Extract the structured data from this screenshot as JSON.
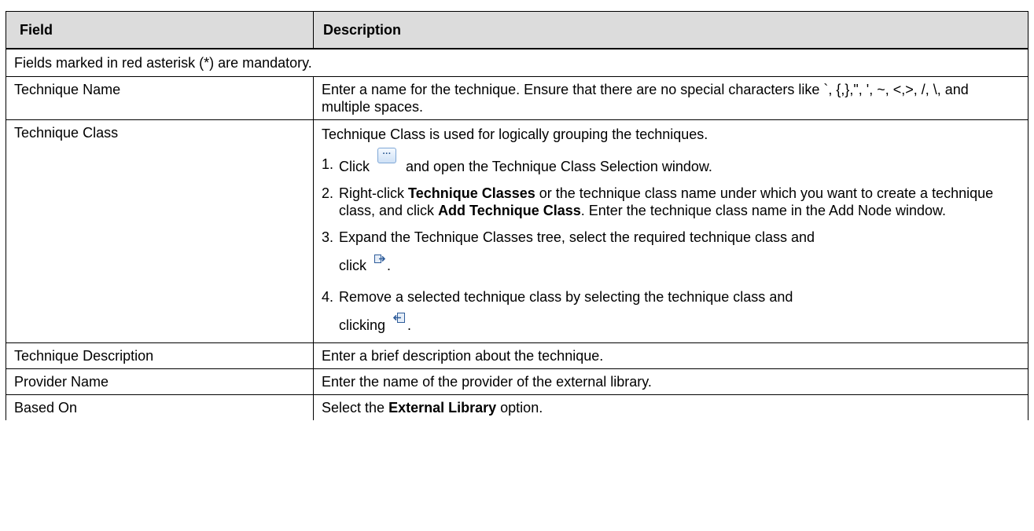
{
  "header": {
    "field": "Field",
    "description": "Description"
  },
  "note": "Fields marked in red asterisk (*) are mandatory.",
  "rows": {
    "technique_name": {
      "field": "Technique Name",
      "description": "Enter a name for the technique. Ensure that there are no special characters like `, {,},\", ', ~, <,>, /, \\, and multiple spaces."
    },
    "technique_class": {
      "field": "Technique Class",
      "intro": "Technique Class is used for logically grouping the techniques.",
      "step1": {
        "num": "1.",
        "pre": "Click",
        "icon": "ellipsis-button-icon",
        "post": "and open the Technique Class Selection window."
      },
      "step2": {
        "num": "2.",
        "pre": "Right-click",
        "bold1": "Technique Classes",
        "mid": "or the technique class name under which you want to create a technique class, and click",
        "bold2": "Add Technique Class",
        "post": ". Enter the technique class name in the Add Node window."
      },
      "step3": {
        "num": "3.",
        "text": "Expand the Technique Classes tree, select the required technique class and",
        "pre": "click",
        "icon": "move-right-icon",
        "post": "."
      },
      "step4": {
        "num": "4.",
        "text": "Remove a selected technique class by selecting the technique class and",
        "pre": "clicking",
        "icon": "move-left-icon",
        "post": "."
      }
    },
    "technique_description": {
      "field": "Technique Description",
      "description": "Enter a brief description about the technique."
    },
    "provider_name": {
      "field": "Provider Name",
      "description": "Enter the name of the provider of the external library."
    },
    "based_on": {
      "field": "Based On",
      "pre": "Select the",
      "bold": "External Library",
      "post": "option."
    }
  }
}
